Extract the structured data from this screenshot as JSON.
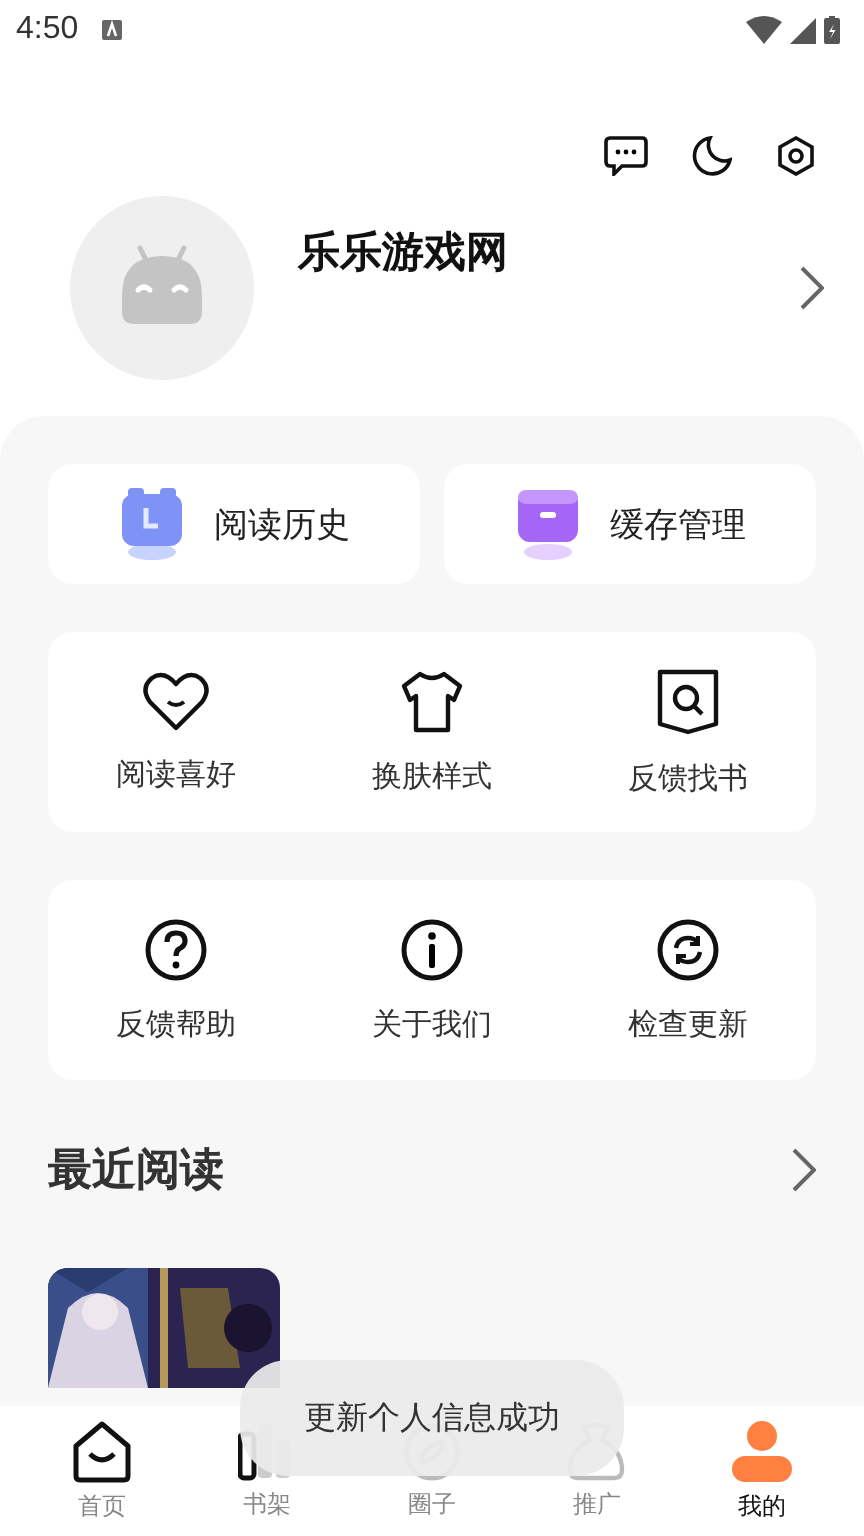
{
  "status_bar": {
    "time": "4:50"
  },
  "profile": {
    "name": "乐乐游戏网"
  },
  "quick_actions": [
    {
      "label": "阅读历史"
    },
    {
      "label": "缓存管理"
    }
  ],
  "tool_groups": [
    [
      {
        "label": "阅读喜好"
      },
      {
        "label": "换肤样式"
      },
      {
        "label": "反馈找书"
      }
    ],
    [
      {
        "label": "反馈帮助"
      },
      {
        "label": "关于我们"
      },
      {
        "label": "检查更新"
      }
    ]
  ],
  "recent": {
    "title": "最近阅读"
  },
  "toast": "更新个人信息成功",
  "tab_bar": [
    {
      "label": "首页",
      "selected": false
    },
    {
      "label": "书架",
      "selected": false
    },
    {
      "label": "圈子",
      "selected": false
    },
    {
      "label": "推广",
      "selected": false
    },
    {
      "label": "我的",
      "selected": true
    }
  ]
}
